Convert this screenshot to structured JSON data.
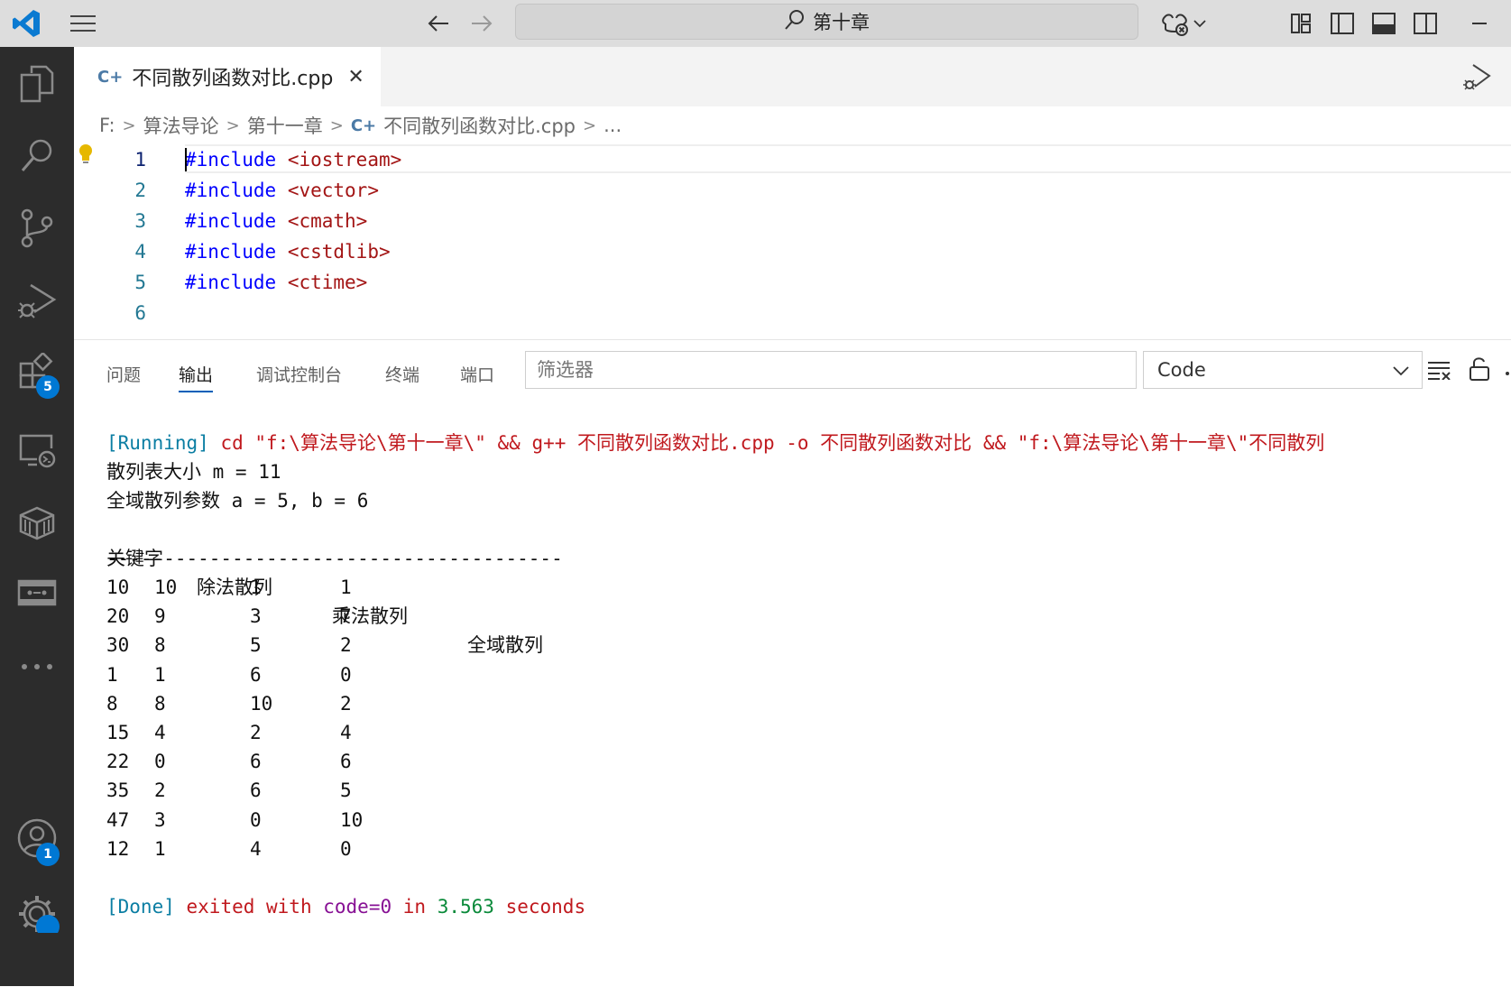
{
  "titlebar": {
    "search_text": "第十章",
    "icons": [
      "vscode-logo-icon",
      "menu-icon",
      "arrow-left-icon",
      "arrow-right-icon",
      "search-icon",
      "copilot-icon",
      "chevron-down-icon",
      "layout-customize-icon",
      "toggle-sidebar-icon",
      "toggle-panel-icon",
      "toggle-secondary-sidebar-icon",
      "minimize-icon"
    ]
  },
  "activitybar": {
    "items": [
      "explorer-icon",
      "search-icon",
      "source-control-icon",
      "run-debug-icon",
      "extensions-icon",
      "remote-explorer-icon",
      "containers-icon",
      "ports-icon",
      "more-icon",
      "accounts-icon",
      "manage-icon"
    ],
    "extensions_badge": "5",
    "accounts_badge": "1"
  },
  "tabs": [
    {
      "label": "不同散列函数对比.cpp",
      "close": "✕",
      "active": true
    }
  ],
  "breadcrumb": [
    "F:",
    "算法导论",
    "第十一章",
    "不同散列函数对比.cpp",
    "..."
  ],
  "editor": {
    "lines": [
      {
        "num": "1",
        "kw": "#include",
        "hdr": "<iostream>"
      },
      {
        "num": "2",
        "kw": "#include",
        "hdr": "<vector>"
      },
      {
        "num": "3",
        "kw": "#include",
        "hdr": "<cmath>"
      },
      {
        "num": "4",
        "kw": "#include",
        "hdr": "<cstdlib>"
      },
      {
        "num": "5",
        "kw": "#include",
        "hdr": "<ctime>"
      },
      {
        "num": "6",
        "kw": "",
        "hdr": ""
      }
    ]
  },
  "panel": {
    "tabs": [
      "问题",
      "输出",
      "调试控制台",
      "终端",
      "端口"
    ],
    "active_tab": "输出",
    "filter_placeholder": "筛选器",
    "channel": "Code",
    "output": {
      "running_tag": "[Running]",
      "running_cmd": "cd \"f:\\算法导论\\第十一章\\\" && g++ 不同散列函数对比.cpp -o 不同散列函数对比 && \"f:\\算法导论\\第十一章\\\"不同散列",
      "line_m": "散列表大小 m = 11",
      "line_ab": "全域散列参数 a = 5, b = 6",
      "headers": [
        "关键字",
        "除法散列",
        "乘法散列",
        "全域散列"
      ],
      "separator": "----------------------------------------",
      "rows": [
        [
          "10",
          "10",
          "1",
          "1"
        ],
        [
          "20",
          "9",
          "3",
          "7"
        ],
        [
          "30",
          "8",
          "5",
          "2"
        ],
        [
          "1",
          "1",
          "6",
          "0"
        ],
        [
          "8",
          "8",
          "10",
          "2"
        ],
        [
          "15",
          "4",
          "2",
          "4"
        ],
        [
          "22",
          "0",
          "6",
          "6"
        ],
        [
          "35",
          "2",
          "6",
          "5"
        ],
        [
          "47",
          "3",
          "0",
          "10"
        ],
        [
          "12",
          "1",
          "4",
          "0"
        ]
      ],
      "done_tag": "[Done]",
      "done_exited": "exited with",
      "done_code": "code=0",
      "done_in": "in",
      "done_time": "3.563",
      "done_seconds": "seconds"
    }
  }
}
